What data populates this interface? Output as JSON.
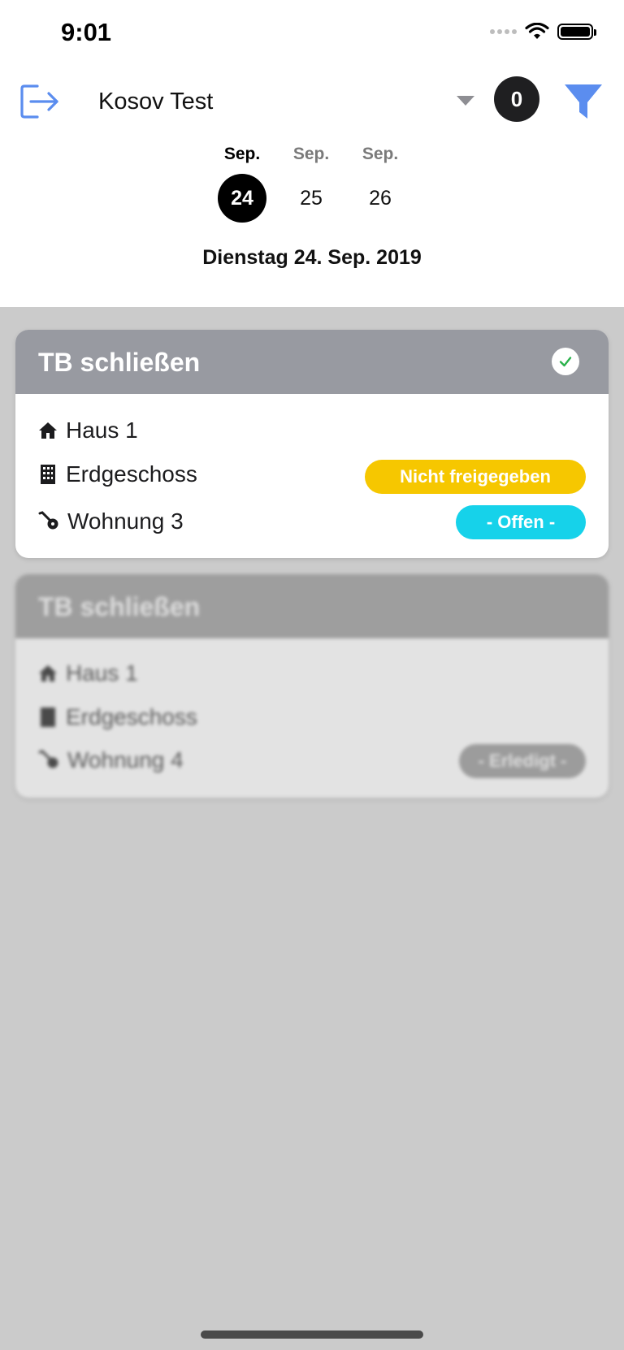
{
  "status_bar": {
    "time": "9:01"
  },
  "header": {
    "user_name": "Kosov Test",
    "count": "0"
  },
  "dates": [
    {
      "month": "Sep.",
      "day": "24",
      "active": true
    },
    {
      "month": "Sep.",
      "day": "25",
      "active": false
    },
    {
      "month": "Sep.",
      "day": "26",
      "active": false
    }
  ],
  "selected_date_label": "Dienstag 24. Sep. 2019",
  "tasks": [
    {
      "title": "TB schließen",
      "completed_check": true,
      "house": "Haus 1",
      "floor": "Erdgeschoss",
      "apartment": "Wohnung 3",
      "release_badge": "Nicht freigegeben",
      "status_badge": "- Offen -"
    },
    {
      "title": "TB schließen",
      "house": "Haus 1",
      "floor": "Erdgeschoss",
      "apartment": "Wohnung 4",
      "status_badge": "- Erledigt -"
    }
  ],
  "colors": {
    "accent_blue": "#5b8def",
    "badge_yellow": "#f6c700",
    "badge_cyan": "#16d2ea",
    "badge_gray": "#9c9c9c",
    "check_green": "#2bb24c"
  }
}
